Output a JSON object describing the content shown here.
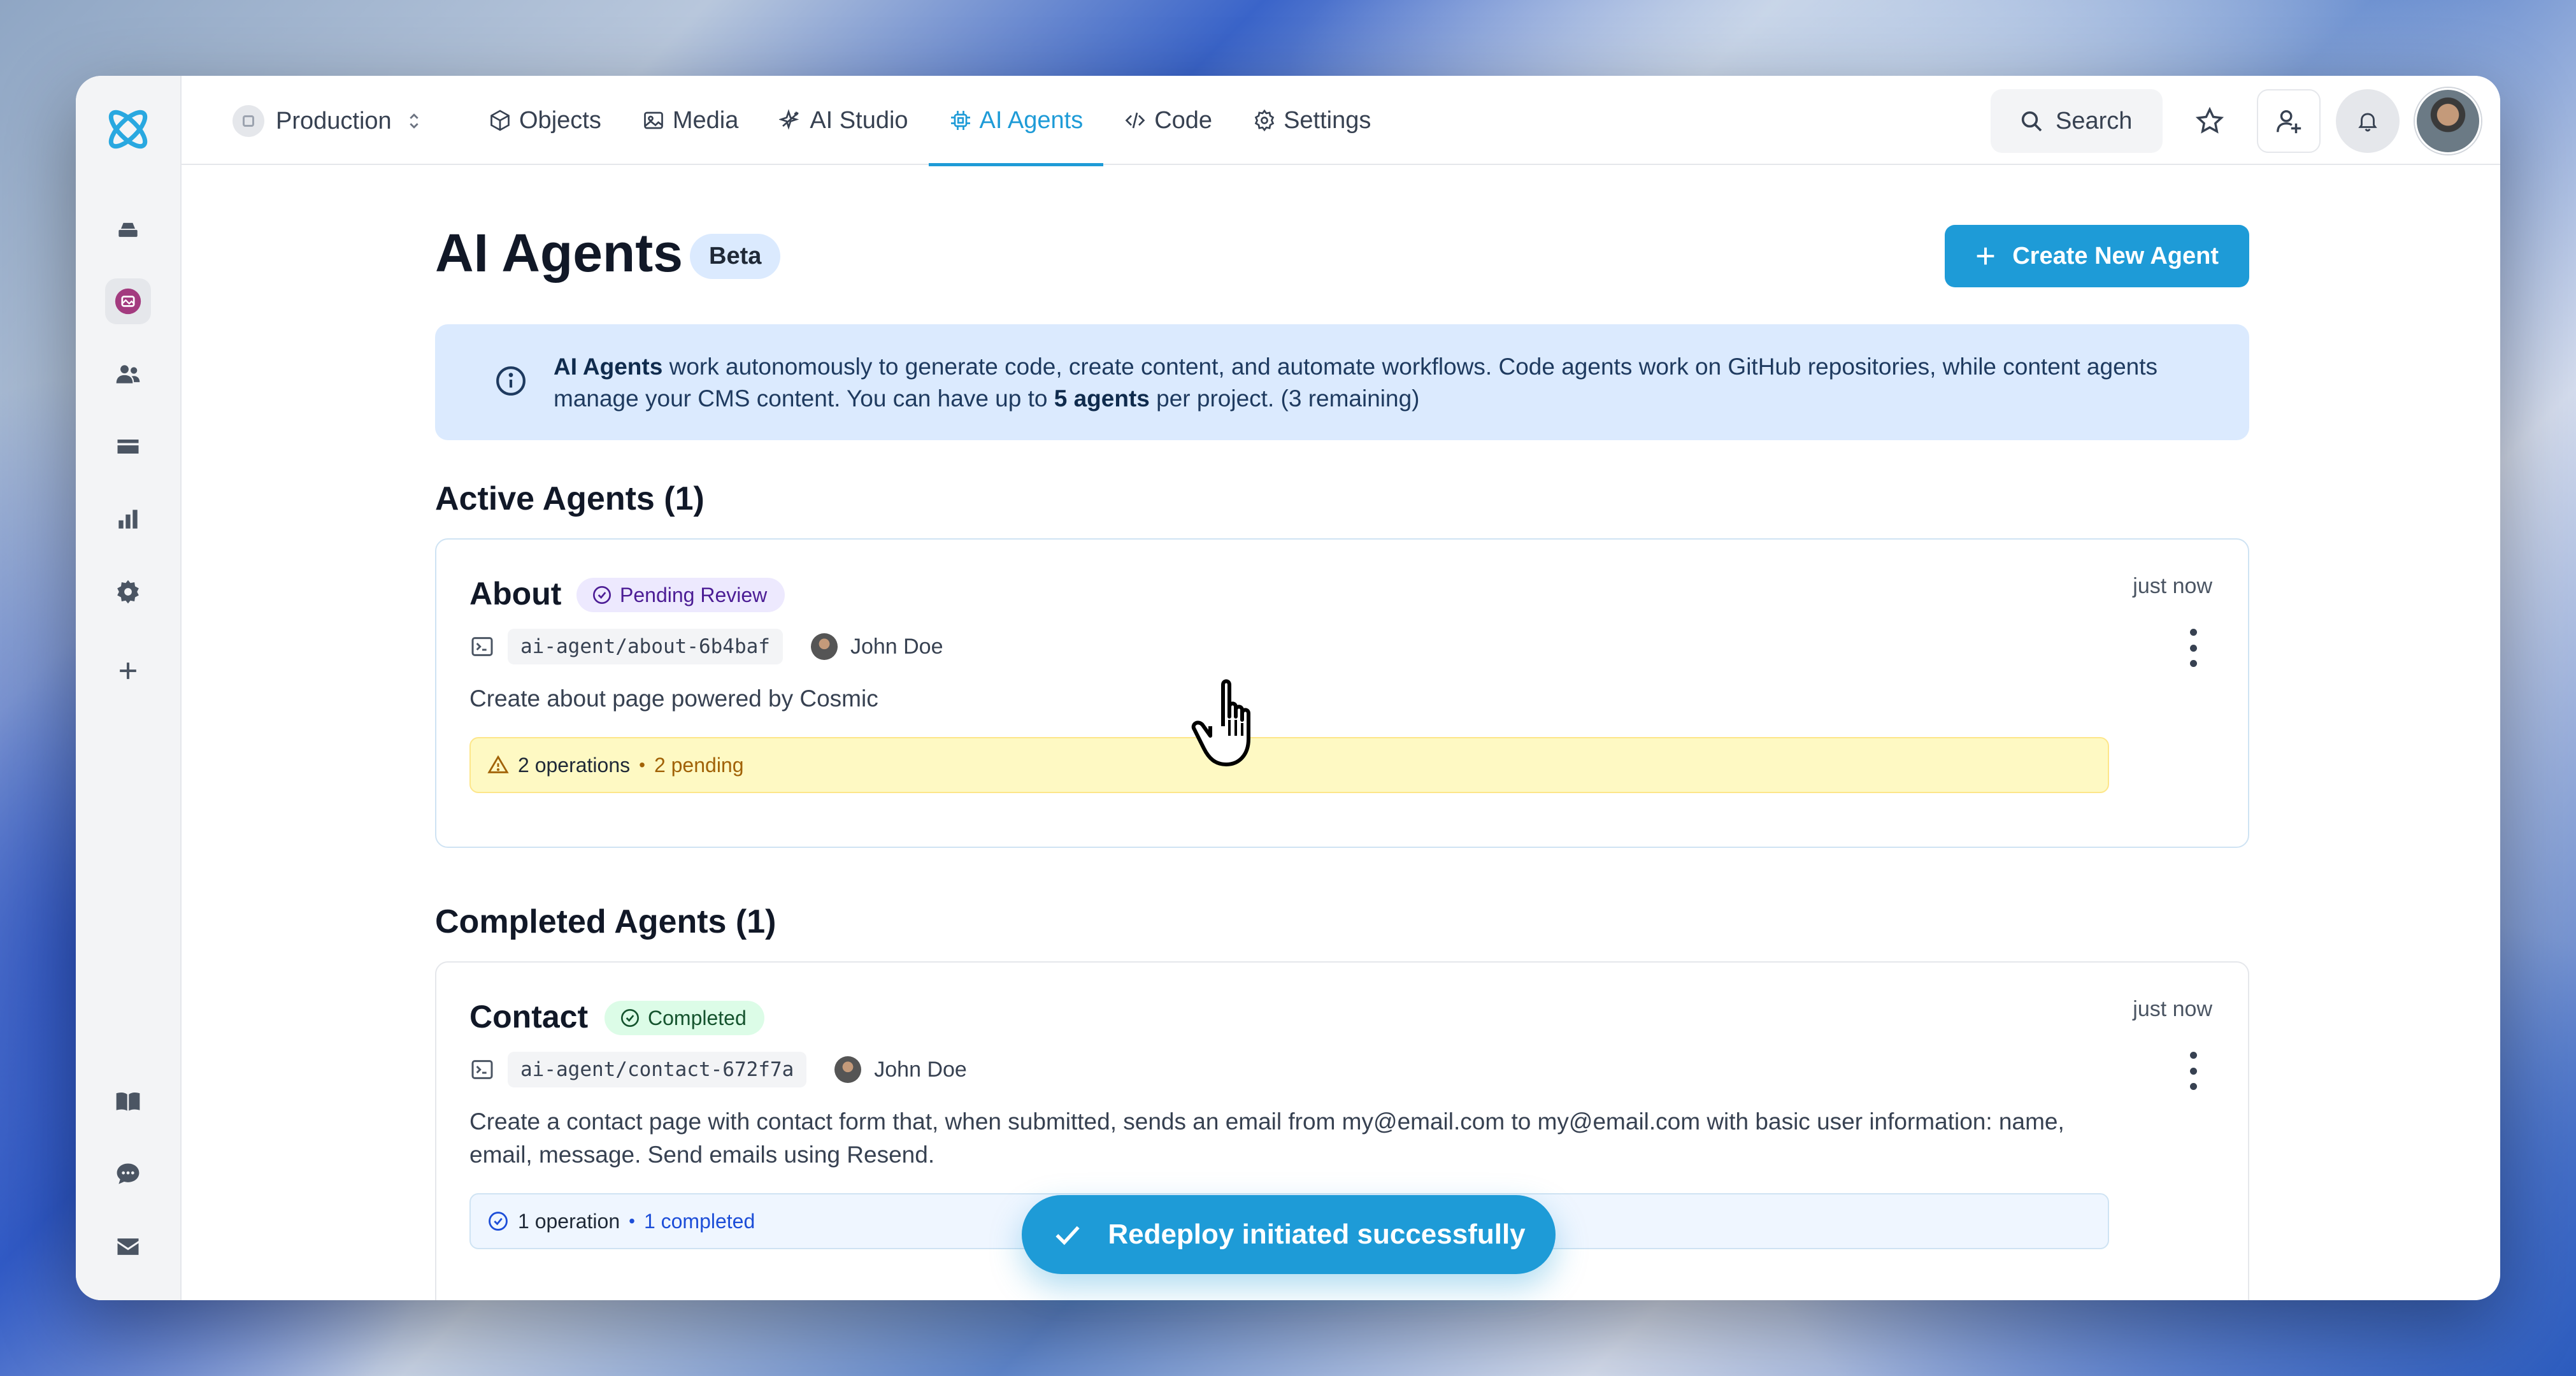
{
  "topbar": {
    "project": "Production",
    "nav": [
      {
        "label": "Objects",
        "icon": "cube-icon"
      },
      {
        "label": "Media",
        "icon": "image-icon"
      },
      {
        "label": "AI Studio",
        "icon": "sparkles-icon"
      },
      {
        "label": "AI Agents",
        "icon": "cpu-icon",
        "active": true
      },
      {
        "label": "Code",
        "icon": "code-icon"
      },
      {
        "label": "Settings",
        "icon": "gear-icon"
      }
    ],
    "search_label": "Search"
  },
  "page": {
    "title": "AI Agents",
    "badge": "Beta",
    "create_button": "Create New Agent"
  },
  "info": {
    "lead": "AI Agents",
    "text1": " work autonomously to generate code, create content, and automate workflows. Code agents work on GitHub repositories, while content agents manage your CMS content. You can have up to ",
    "limit": "5 agents",
    "text2": " per project. (3 remaining)"
  },
  "active": {
    "heading": "Active Agents (1)",
    "agent": {
      "name": "About",
      "status": "Pending Review",
      "time": "just now",
      "branch": "ai-agent/about-6b4baf",
      "author": "John Doe",
      "description": "Create about page powered by Cosmic",
      "ops_count": "2 operations",
      "ops_status": "2 pending"
    }
  },
  "completed": {
    "heading": "Completed Agents (1)",
    "agent": {
      "name": "Contact",
      "status": "Completed",
      "time": "just now",
      "branch": "ai-agent/contact-672f7a",
      "author": "John Doe",
      "description": "Create a contact page with contact form that, when submitted, sends an email from my@email.com to my@email.com with basic user information: name, email, message. Send emails using Resend.",
      "ops_count": "1 operation",
      "ops_status": "1 completed"
    }
  },
  "toast": {
    "message": "Redeploy initiated successfully"
  },
  "colors": {
    "accent": "#1e9bd7",
    "info_bg": "#dbeafe",
    "pending_bg": "#ede9fe",
    "completed_bg": "#dcfce7",
    "warning_bg": "#fef9c3"
  }
}
